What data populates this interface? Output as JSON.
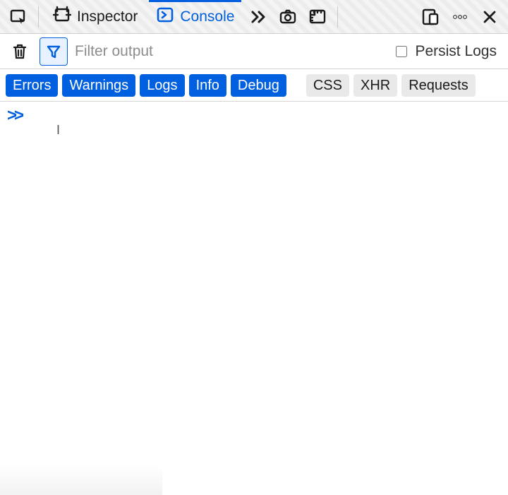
{
  "tabs": {
    "inspector": {
      "label": "Inspector"
    },
    "console": {
      "label": "Console"
    }
  },
  "filterbar": {
    "placeholder": "Filter output",
    "persist_label": "Persist Logs",
    "persist_checked": false
  },
  "levels": {
    "errors": {
      "label": "Errors",
      "active": true
    },
    "warnings": {
      "label": "Warnings",
      "active": true
    },
    "logs": {
      "label": "Logs",
      "active": true
    },
    "info": {
      "label": "Info",
      "active": true
    },
    "debug": {
      "label": "Debug",
      "active": true
    },
    "css": {
      "label": "CSS",
      "active": false
    },
    "xhr": {
      "label": "XHR",
      "active": false
    },
    "requests": {
      "label": "Requests",
      "active": false
    }
  },
  "prompt": {
    "marker": "»",
    "value": ""
  }
}
